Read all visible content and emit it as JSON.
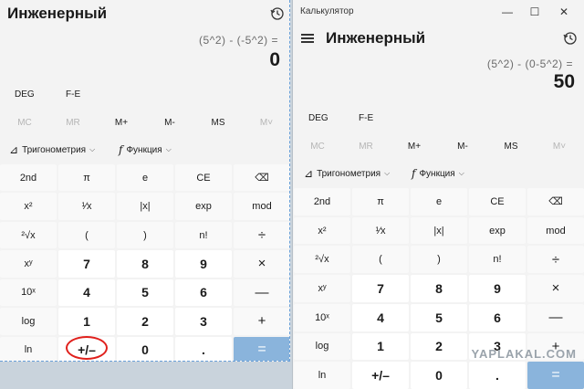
{
  "left": {
    "mode": "Инженерный",
    "expression": "(5^2) - (-5^2) =",
    "result": "0",
    "angle_unit": "DEG",
    "fe": "F-E",
    "memory": [
      "MC",
      "MR",
      "M+",
      "M-",
      "MS",
      "M˅"
    ],
    "trig_label": "Тригонометрия",
    "func_label": "Функция",
    "keys": [
      [
        "2nd",
        "π",
        "e",
        "CE",
        "⌫"
      ],
      [
        "x²",
        "¹⁄x",
        "|x|",
        "exp",
        "mod"
      ],
      [
        "²√x",
        "(",
        ")",
        "n!",
        "÷"
      ],
      [
        "xʸ",
        "7",
        "8",
        "9",
        "×"
      ],
      [
        "10ˣ",
        "4",
        "5",
        "6",
        "—"
      ],
      [
        "log",
        "1",
        "2",
        "3",
        "+"
      ],
      [
        "ln",
        "+/–",
        "0",
        ".",
        "="
      ]
    ]
  },
  "right": {
    "window_title": "Калькулятор",
    "mode": "Инженерный",
    "expression": "(5^2) - (0-5^2) =",
    "result": "50",
    "angle_unit": "DEG",
    "fe": "F-E",
    "memory": [
      "MC",
      "MR",
      "M+",
      "M-",
      "MS",
      "M˅"
    ],
    "trig_label": "Тригонометрия",
    "func_label": "Функция",
    "keys": [
      [
        "2nd",
        "π",
        "e",
        "CE",
        "⌫"
      ],
      [
        "x²",
        "¹⁄x",
        "|x|",
        "exp",
        "mod"
      ],
      [
        "²√x",
        "(",
        ")",
        "n!",
        "÷"
      ],
      [
        "xʸ",
        "7",
        "8",
        "9",
        "×"
      ],
      [
        "10ˣ",
        "4",
        "5",
        "6",
        "—"
      ],
      [
        "log",
        "1",
        "2",
        "3",
        "+"
      ],
      [
        "ln",
        "+/–",
        "0",
        ".",
        "="
      ]
    ]
  },
  "watermark": "YAPLAKAL.COM"
}
